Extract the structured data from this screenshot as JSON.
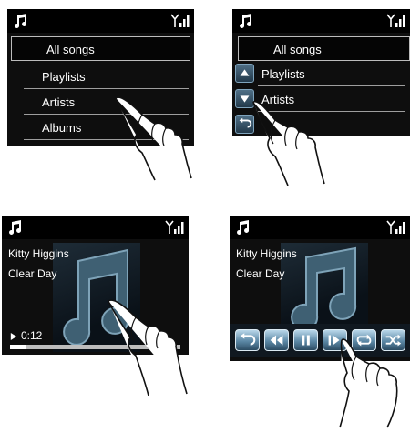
{
  "panel1": {
    "menu": [
      "All songs",
      "Playlists",
      "Artists",
      "Albums"
    ]
  },
  "panel2": {
    "menu": [
      "All songs",
      "Playlists",
      "Artists"
    ]
  },
  "panel3": {
    "artist": "Kitty Higgins",
    "title": "Clear Day",
    "elapsed": "0:12",
    "progress_fraction": 0.09
  },
  "panel4": {
    "artist": "Kitty Higgins",
    "title": "Clear Day",
    "controls": [
      "repeat-back-icon",
      "rewind-icon",
      "pause-icon",
      "next-icon",
      "repeat-icon",
      "shuffle-icon"
    ]
  },
  "colors": {
    "screen_bg": "#0e0e0e",
    "accent_button": "#5c88a6",
    "text": "#ffffff"
  }
}
